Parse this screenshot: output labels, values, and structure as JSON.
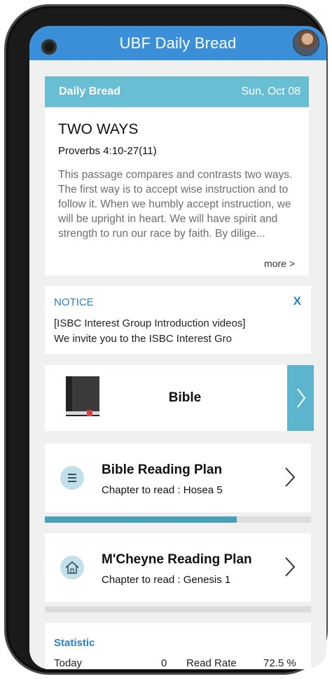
{
  "app": {
    "title": "UBF Daily Bread"
  },
  "daily_bread": {
    "label": "Daily Bread",
    "date": "Sun, Oct 08",
    "title": "TWO WAYS",
    "reference": "Proverbs 4:10-27(11)",
    "summary": "This passage compares and contrasts two ways. The first way is to accept wise instruction and to follow it. When we humbly accept instruction, we will be upright in heart. We will have spirit and strength to run our race by faith. By dilige...",
    "more_label": "more >"
  },
  "notice": {
    "label": "NOTICE",
    "close_label": "X",
    "line1": "[ISBC Interest Group Introduction videos]",
    "line2": "We invite you to the ISBC Interest Gro"
  },
  "bible": {
    "label": "Bible"
  },
  "reading_plans": [
    {
      "title": "Bible Reading Plan",
      "subtitle": "Chapter to read : Hosea 5",
      "icon": "list-icon",
      "progress": 0.72
    },
    {
      "title": "M'Cheyne Reading Plan",
      "subtitle": "Chapter to read : Genesis 1",
      "icon": "home-icon",
      "progress": 0
    }
  ],
  "statistic": {
    "label": "Statistic",
    "today_label": "Today",
    "today_value": "0",
    "read_rate_label": "Read Rate",
    "read_rate_value": "72.5 %"
  },
  "colors": {
    "topbar": "#3a8fd8",
    "header": "#68bed3",
    "accent": "#2d7fc9",
    "progress": "#4aa0b5",
    "chevron_block": "#5cb5cc"
  }
}
